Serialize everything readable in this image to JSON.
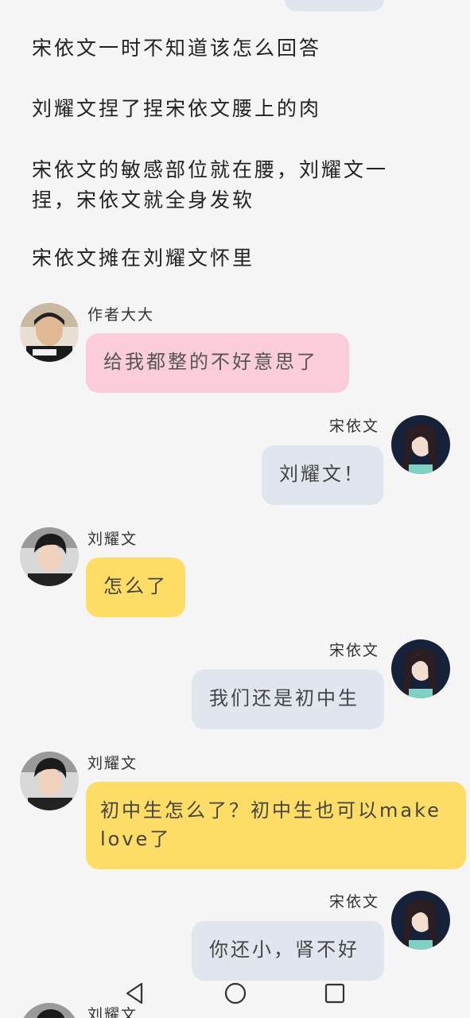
{
  "narration": [
    "宋依文一时不知道该怎么回答",
    "刘耀文捏了捏宋依文腰上的肉",
    "宋依文的敏感部位就在腰，刘耀文一捏，宋依文就全身发软",
    "宋依文摊在刘耀文怀里"
  ],
  "messages": [
    {
      "sender": "作者大大",
      "side": "left",
      "text": "给我都整的不好意思了",
      "color": "#fbcdd8"
    },
    {
      "sender": "宋依文",
      "side": "right",
      "text": "刘耀文！",
      "color": "#e1e6ee"
    },
    {
      "sender": "刘耀文",
      "side": "left",
      "text": "怎么了",
      "color": "#fddd66"
    },
    {
      "sender": "宋依文",
      "side": "right",
      "text": "我们还是初中生",
      "color": "#e1e6ee"
    },
    {
      "sender": "刘耀文",
      "side": "left",
      "text": "初中生怎么了？初中生也可以make love了",
      "color": "#fddd66"
    },
    {
      "sender": "宋依文",
      "side": "right",
      "text": "你还小，肾不好",
      "color": "#e1e6ee"
    },
    {
      "sender": "刘耀文",
      "side": "left",
      "text": "",
      "color": "#fddd66"
    }
  ],
  "nav": {
    "back_icon": "back-triangle-icon",
    "home_icon": "home-circle-icon",
    "recents_icon": "recents-square-icon"
  }
}
